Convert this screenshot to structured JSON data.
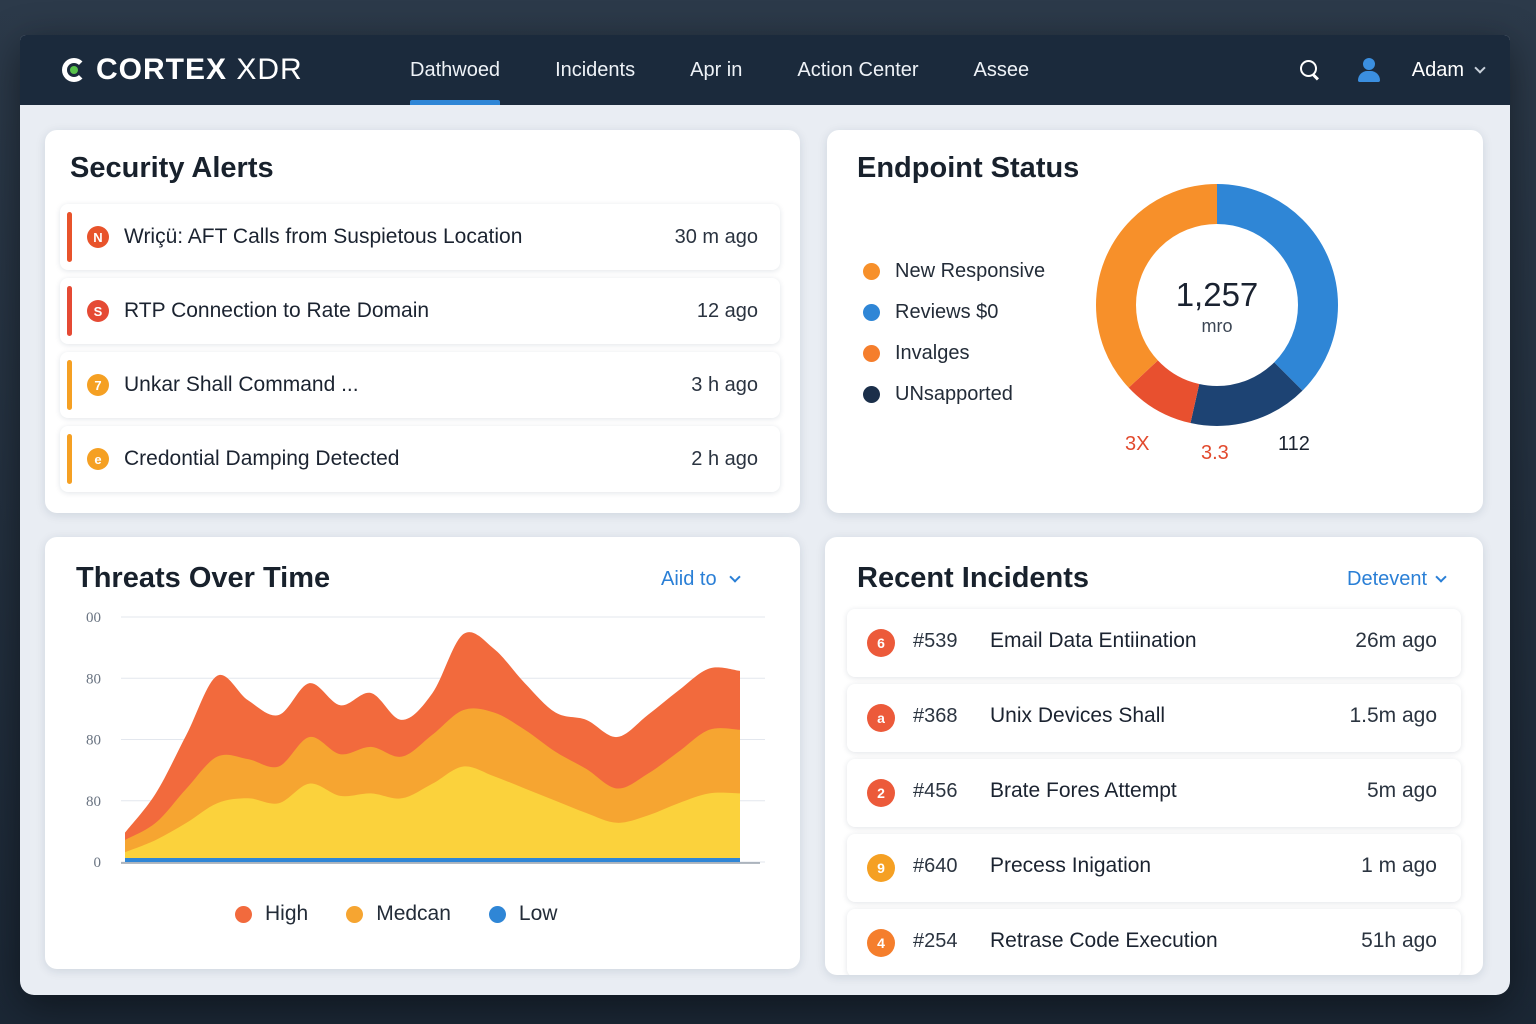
{
  "app": {
    "logo": {
      "strong": "CORTEX",
      "light": " XDR"
    },
    "nav": [
      {
        "label": "Dathwoed",
        "active": true
      },
      {
        "label": "Incidents",
        "active": false
      },
      {
        "label": "Apr in",
        "active": false
      },
      {
        "label": "Action Center",
        "active": false
      },
      {
        "label": "Assee",
        "active": false
      }
    ],
    "user": {
      "name": "Adam"
    }
  },
  "security_alerts": {
    "title": "Security Alerts",
    "items": [
      {
        "title": "Wriçü: AFT Calls from Suspietous Location",
        "time": "30 m ago",
        "icon": "N",
        "color": "#e8532b"
      },
      {
        "title": "RTP Connection to Rate Domain",
        "time": "12 ago",
        "icon": "S",
        "color": "#e54a34"
      },
      {
        "title": "Unkar Shall Command ...",
        "time": "3 h ago",
        "icon": "7",
        "color": "#f5a023"
      },
      {
        "title": "Credontial Damping Detected",
        "time": "2 h ago",
        "icon": "e",
        "color": "#f5a023"
      }
    ]
  },
  "endpoint_status": {
    "title": "Endpoint Status",
    "legend": [
      {
        "label": "New Responsive",
        "color": "#f7902a"
      },
      {
        "label": "Reviews $0",
        "color": "#2f86d6"
      },
      {
        "label": "Invalges",
        "color": "#f57e2c"
      },
      {
        "label": "UNsapported",
        "color": "#1b2f4a"
      }
    ],
    "center_value": "1,257",
    "center_unit": "mro",
    "segment_labels": [
      {
        "text": "3X",
        "color": "#e24a2e"
      },
      {
        "text": "3.3",
        "color": "#e24a2e"
      },
      {
        "text": "112",
        "color": "#1b2330"
      }
    ],
    "segments": [
      {
        "name": "blue",
        "fraction": 0.375,
        "color": "#2f86d6"
      },
      {
        "name": "navy",
        "fraction": 0.16,
        "color": "#1d4373"
      },
      {
        "name": "red",
        "fraction": 0.095,
        "color": "#e8502f"
      },
      {
        "name": "orange",
        "fraction": 0.37,
        "color": "#f7902a"
      }
    ]
  },
  "threats": {
    "title": "Threats Over Time",
    "filter_label": "Aiid to",
    "legend": [
      {
        "label": "High",
        "color": "#f26a3d"
      },
      {
        "label": "Medcan",
        "color": "#f6a531"
      },
      {
        "label": "Low",
        "color": "#2f86d6"
      }
    ]
  },
  "chart_data": {
    "type": "area",
    "y_ticks": [
      "00",
      "80",
      "80",
      "80",
      "0"
    ],
    "ylim": [
      0,
      100
    ],
    "x": [
      0,
      1,
      2,
      3,
      4,
      5,
      6,
      7,
      8,
      9,
      10,
      11,
      12,
      13,
      14,
      15,
      16,
      17,
      18,
      19,
      20
    ],
    "series": [
      {
        "name": "High",
        "color": "#f26a3d",
        "values": [
          12,
          28,
          52,
          76,
          66,
          60,
          73,
          64,
          69,
          58,
          69,
          93,
          87,
          73,
          61,
          58,
          51,
          60,
          70,
          79,
          78
        ]
      },
      {
        "name": "Medcan",
        "color": "#f6a531",
        "values": [
          9,
          16,
          30,
          43,
          42,
          39,
          51,
          44,
          47,
          43,
          52,
          62,
          61,
          54,
          45,
          38,
          30,
          36,
          45,
          54,
          54
        ]
      },
      {
        "name": "Low",
        "color": "#2f86d6",
        "values": [
          1,
          1,
          1,
          1,
          1,
          1,
          1,
          1,
          1,
          1,
          1,
          1,
          1,
          1,
          1,
          1,
          1,
          1,
          1,
          1,
          1
        ]
      }
    ],
    "mid_layer": {
      "color": "#fbd23c",
      "values": [
        4,
        9,
        16,
        24,
        26,
        24,
        32,
        27,
        28,
        26,
        32,
        39,
        35,
        30,
        25,
        20,
        16,
        19,
        24,
        28,
        28
      ]
    }
  },
  "recent_incidents": {
    "title": "Recent Incidents",
    "filter_label": "Detevent",
    "items": [
      {
        "num": "#539",
        "title": "Email Data Entiination",
        "time": "26m ago",
        "icon": "6",
        "color": "#ec5a3a"
      },
      {
        "num": "#368",
        "title": "Unix Devices Shall",
        "time": "1.5m ago",
        "icon": "a",
        "color": "#ec5a3a"
      },
      {
        "num": "#456",
        "title": "Brate Fores Attempt",
        "time": "5m ago",
        "icon": "2",
        "color": "#ec5a3a"
      },
      {
        "num": "#640",
        "title": "Precess Inigation",
        "time": "1 m ago",
        "icon": "9",
        "color": "#f5a023"
      },
      {
        "num": "#254",
        "title": "Retrase Code Execution",
        "time": "51h ago",
        "icon": "4",
        "color": "#f57e2c"
      }
    ]
  }
}
